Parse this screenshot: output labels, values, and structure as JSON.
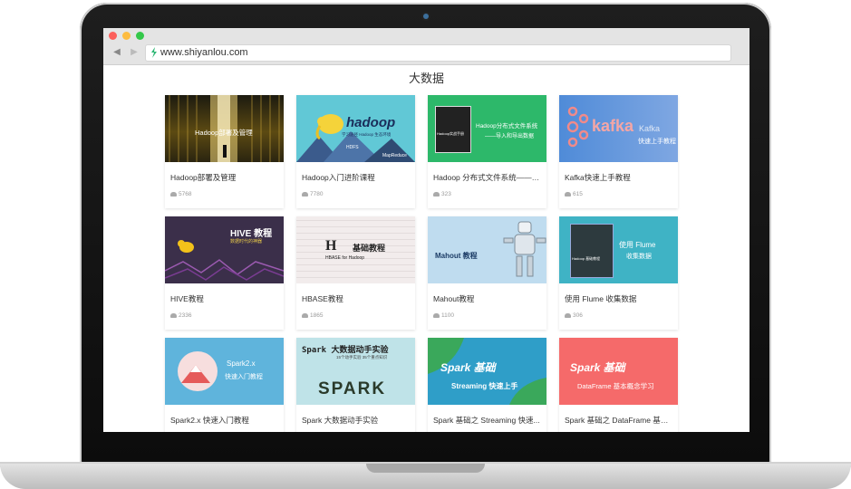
{
  "browser": {
    "url": "www.shiyanlou.com"
  },
  "page": {
    "title": "大数据"
  },
  "courses": [
    {
      "title": "Hadoop部署及管理",
      "count": "5768",
      "thumb_text": "Hadoop部署及管理"
    },
    {
      "title": "Hadoop入门进阶课程",
      "count": "7780",
      "thumb_text": "hadoop"
    },
    {
      "title": "Hadoop 分布式文件系统——导...",
      "count": "323",
      "thumb_text": "Hadoop分布式文件系统"
    },
    {
      "title": "Kafka快速上手教程",
      "count": "615",
      "thumb_text": "kafka"
    },
    {
      "title": "HIVE教程",
      "count": "2336",
      "thumb_text": "HIVE 教程"
    },
    {
      "title": "HBASE教程",
      "count": "1865",
      "thumb_text": "基础教程"
    },
    {
      "title": "Mahout教程",
      "count": "1100",
      "thumb_text": "Mahout 教程"
    },
    {
      "title": "使用 Flume 收集数据",
      "count": "306",
      "thumb_text": "使用 Flume"
    },
    {
      "title": "Spark2.x 快速入门教程",
      "count": "",
      "thumb_text": "Spark2.x"
    },
    {
      "title": "Spark 大数据动手实验",
      "count": "",
      "thumb_text": "Spark 大数据动手实验"
    },
    {
      "title": "Spark 基础之 Streaming 快速...",
      "count": "",
      "thumb_text": "Spark 基础"
    },
    {
      "title": "Spark 基础之 DataFrame 基本...",
      "count": "",
      "thumb_text": "Spark 基础"
    }
  ],
  "thumb_extra": {
    "hdfs_sub": "——导入和导出数据",
    "hdfs_book": "Hadoop实战手册",
    "kafka_sub": "Kafka",
    "kafka_sub2": "快速上手教程",
    "hadoop_sub": "学习途径 Hadoop 生态环境",
    "hdfs_label": "HDFS",
    "mapreduce_label": "MapReduce",
    "hive_sub": "数据时代的神器",
    "hbase_sub": "HBASE for Hadoop",
    "flume_sub": "收集数据",
    "flume_book": "Hadoop 基础教程",
    "spark2_sub": "快速入门教程",
    "spark_lab_sub": "15个动手实验 35个重点知识",
    "spark_big": "SPARK",
    "streaming_sub": "Streaming 快速上手",
    "dataframe_sub": "DataFrame 基本概念学习"
  },
  "colors": {
    "hadoop_bg": "#61c8d6",
    "hdfs_bg": "#2db86a",
    "kafka_bg": "#5a93d6",
    "hive_bg": "#3b2f4a",
    "mahout_bg": "#bfdcef",
    "flume_bg": "#3fb3c5",
    "spark2_bg": "#5fb4dc",
    "spark_lab_bg": "#bfe3e8",
    "streaming_bg": "#2f9ec8",
    "dataframe_bg": "#f56a6a"
  }
}
